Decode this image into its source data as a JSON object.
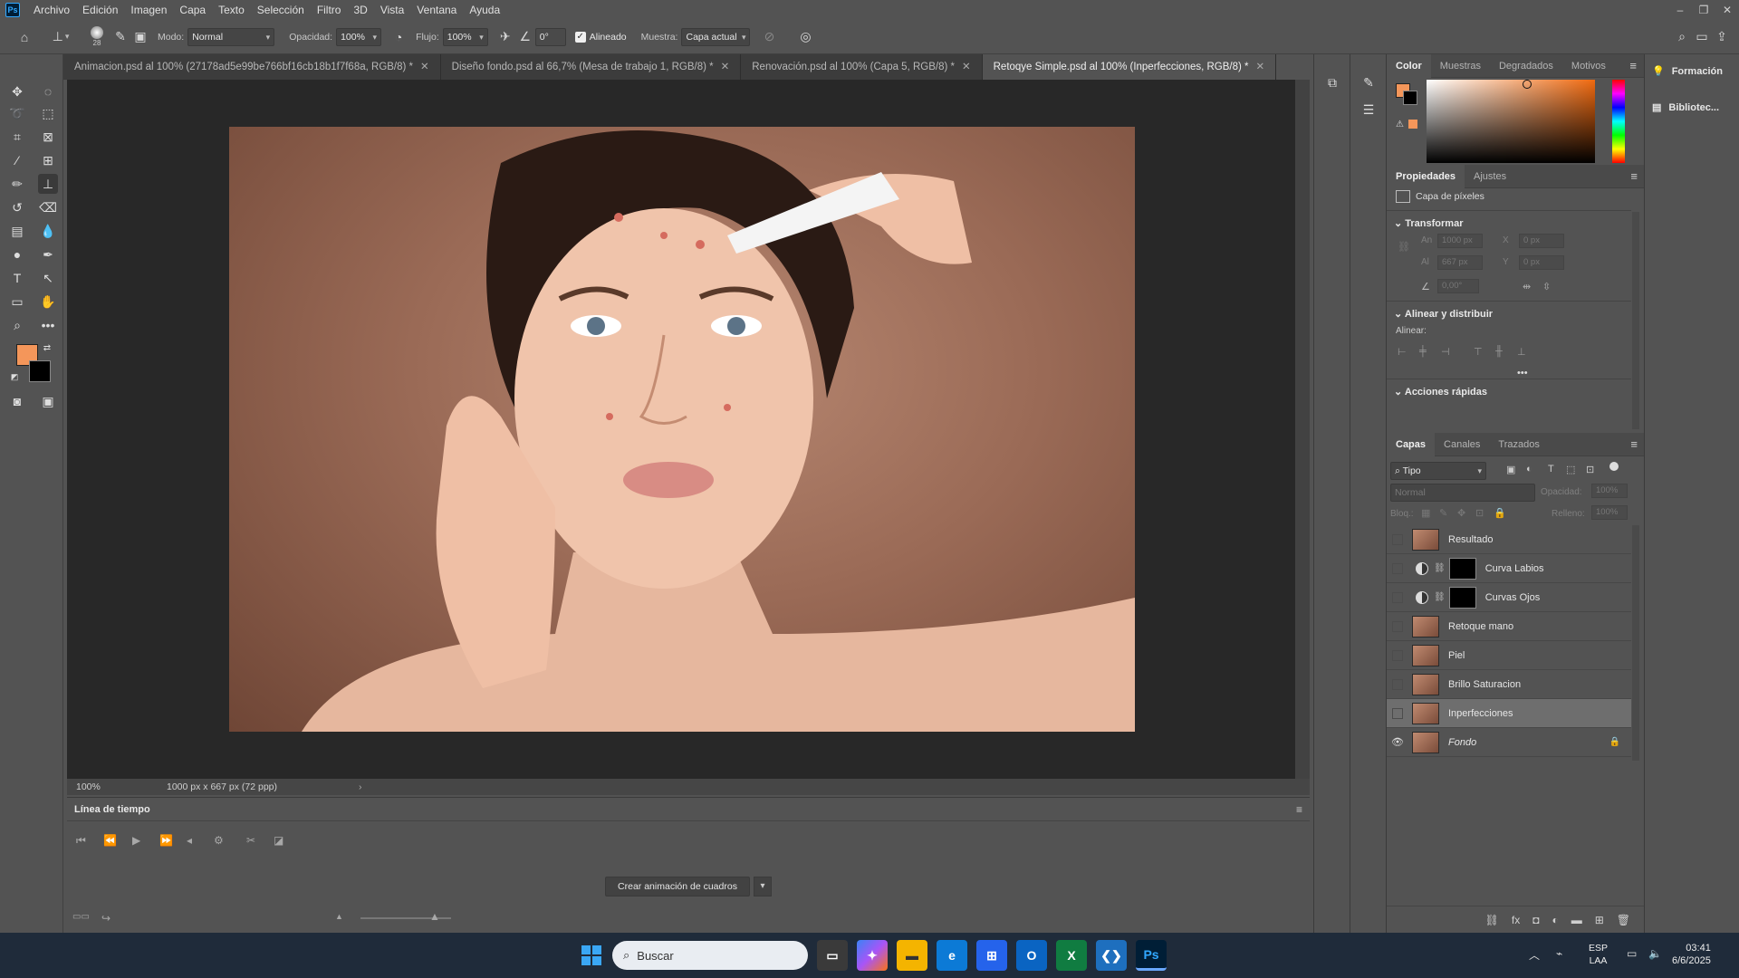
{
  "menubar": {
    "app_icon_label": "Ps",
    "items": [
      "Archivo",
      "Edición",
      "Imagen",
      "Capa",
      "Texto",
      "Selección",
      "Filtro",
      "3D",
      "Vista",
      "Ventana",
      "Ayuda"
    ],
    "window_controls": [
      "–",
      "❐",
      "✕"
    ]
  },
  "options": {
    "brush_size": "28",
    "mode_label": "Modo:",
    "mode_value": "Normal",
    "opacity_label": "Opacidad:",
    "opacity_value": "100%",
    "flow_label": "Flujo:",
    "flow_value": "100%",
    "angle_value": "0°",
    "aligned_label": "Alineado",
    "aligned_checked": true,
    "sample_label": "Muestra:",
    "sample_value": "Capa actual"
  },
  "tabs": [
    {
      "title": "Animacion.psd al 100% (27178ad5e99be766bf16cb18b1f7f68a, RGB/8) *",
      "active": false
    },
    {
      "title": "Diseño fondo.psd al 66,7% (Mesa de trabajo 1, RGB/8) *",
      "active": false
    },
    {
      "title": "Renovación.psd al 100% (Capa 5, RGB/8) *",
      "active": false
    },
    {
      "title": "Retoqye Simple.psd al 100% (Inperfecciones, RGB/8) *",
      "active": true
    }
  ],
  "status": {
    "zoom": "100%",
    "doc_info": "1000 px x 667 px (72 ppp)"
  },
  "timeline": {
    "title": "Línea de tiempo",
    "create_button": "Crear animación de cuadros"
  },
  "color_panel": {
    "tabs": [
      "Color",
      "Muestras",
      "Degradados",
      "Motivos"
    ],
    "foreground": "#f4965a",
    "background": "#000000"
  },
  "properties_panel": {
    "tabs": [
      "Propiedades",
      "Ajustes"
    ],
    "layer_type": "Capa de píxeles",
    "transform_title": "Transformar",
    "w_label": "An",
    "w_value": "1000 px",
    "h_label": "Al",
    "h_value": "667 px",
    "x_label": "X",
    "x_value": "0 px",
    "y_label": "Y",
    "y_value": "0 px",
    "angle_value": "0,00°",
    "align_title": "Alinear y distribuir",
    "align_label": "Alinear:",
    "quick_actions_title": "Acciones rápidas"
  },
  "layers_panel": {
    "tabs": [
      "Capas",
      "Canales",
      "Trazados"
    ],
    "filter_value": "Tipo",
    "blend_value": "Normal",
    "opacity_label": "Opacidad:",
    "opacity_value": "100%",
    "lock_label": "Bloq.:",
    "fill_label": "Relleno:",
    "fill_value": "100%",
    "layers": [
      {
        "name": "Resultado",
        "kind": "pixel",
        "visible": false,
        "selected": false
      },
      {
        "name": "Curva Labios",
        "kind": "adjustment",
        "visible": false,
        "selected": false
      },
      {
        "name": "Curvas Ojos",
        "kind": "adjustment",
        "visible": false,
        "selected": false
      },
      {
        "name": "Retoque mano",
        "kind": "pixel",
        "visible": false,
        "selected": false
      },
      {
        "name": "Piel",
        "kind": "pixel",
        "visible": false,
        "selected": false
      },
      {
        "name": "Brillo Saturacion",
        "kind": "pixel",
        "visible": false,
        "selected": false
      },
      {
        "name": "Inperfecciones",
        "kind": "pixel",
        "visible": false,
        "selected": true
      },
      {
        "name": "Fondo",
        "kind": "pixel",
        "visible": true,
        "selected": false,
        "locked": true
      }
    ]
  },
  "far_right": {
    "items": [
      "Formación",
      "Bibliotec..."
    ]
  },
  "taskbar": {
    "search_placeholder": "Buscar",
    "lang_top": "ESP",
    "lang_bottom": "LAA",
    "time": "03:41",
    "date": "6/6/2025"
  }
}
